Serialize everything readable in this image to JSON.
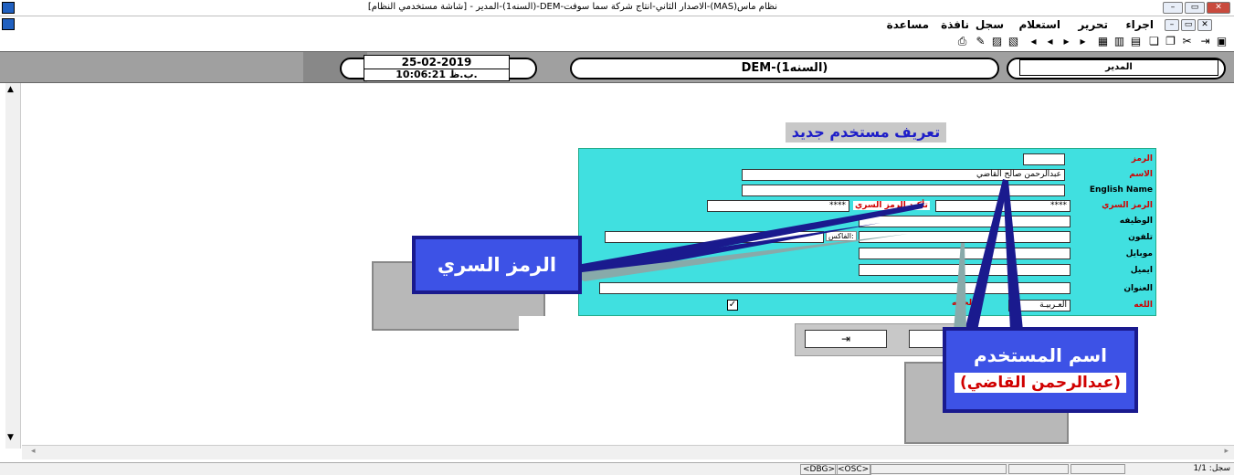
{
  "window": {
    "title": "نظام ماس(MAS)-الاصدار الثاني-انتاج شركة سما سوفت-DEM-(السنه1)-المدير - [شاشة مستخدمي النظام]"
  },
  "menu": {
    "items": [
      "اجراء",
      "تحرير",
      "استعلام",
      "سجل",
      "نافذة",
      "مساعدة"
    ]
  },
  "header": {
    "date": "25-02-2019",
    "time": "10:06:21 ب.ظ.",
    "company": "DEM-(السنه1)",
    "user": "المدير"
  },
  "form": {
    "title": "تعريف مستخدم جديد",
    "code_label": "الرمز",
    "code_value": "",
    "name_label": "الاسم",
    "name_value": "عبدالرحمن صالح القاضي",
    "english_name_label": "English Name",
    "english_name_value": "",
    "password_label": "الرمز السري",
    "password_value": "****",
    "confirm_password_label": "تأكيد الرمز السري",
    "confirm_password_value": "****",
    "job_label": "الوظيفه",
    "phone_label": "تلفون",
    "fax_label": "الفاكس:",
    "mobile_label": "موبايل",
    "email_label": "ايميل",
    "address_label": "العنوان",
    "language_label": "اللغه",
    "language_value": "العـربيـة",
    "status_label": "الحاله",
    "status_checked": true,
    "save_icon": "⇥"
  },
  "callouts": {
    "password": "الرمز السري",
    "username_title": "اسم المستخدم",
    "username_name": "(عبدالرحمن القاضي)"
  },
  "status": {
    "dbg": "<DBG>",
    "osc": "<OSC>",
    "record": "سجل: 1/1"
  },
  "colors": {
    "panel": "#40e0e0",
    "callout": "#3d52e6",
    "required_label": "#d00000"
  }
}
